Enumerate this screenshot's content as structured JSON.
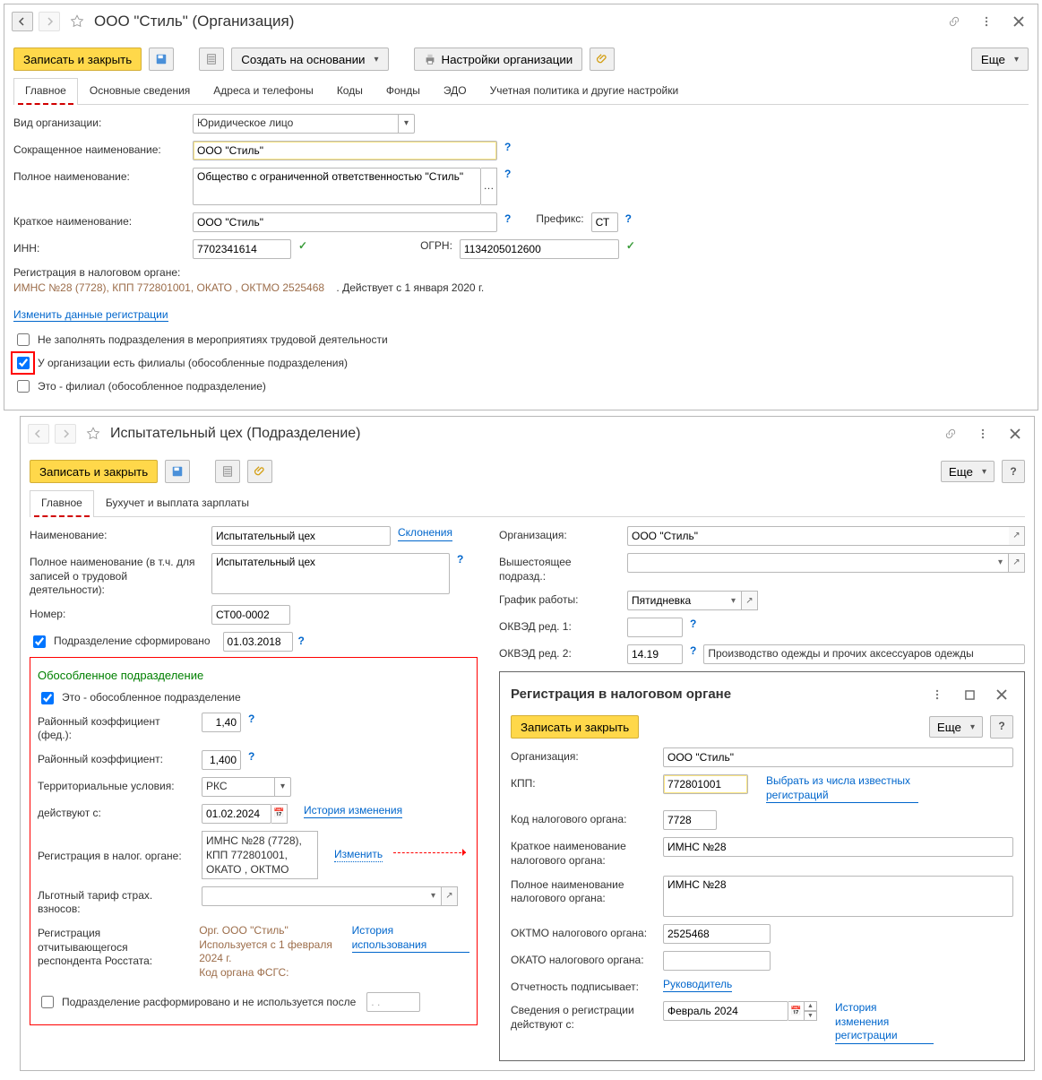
{
  "org_window": {
    "title": "ООО \"Стиль\" (Организация)",
    "toolbar": {
      "save_close": "Записать и закрыть",
      "create_from": "Создать на основании",
      "org_settings": "Настройки организации",
      "more": "Еще"
    },
    "tabs": [
      "Главное",
      "Основные сведения",
      "Адреса и телефоны",
      "Коды",
      "Фонды",
      "ЭДО",
      "Учетная политика и другие настройки"
    ],
    "fields": {
      "kind_label": "Вид организации:",
      "kind_value": "Юридическое лицо",
      "short_label": "Сокращенное наименование:",
      "short_value": "ООО \"Стиль\"",
      "full_label": "Полное наименование:",
      "full_value": "Общество с ограниченной ответственностью \"Стиль\"",
      "brief_label": "Краткое наименование:",
      "brief_value": "ООО \"Стиль\"",
      "prefix_label": "Префикс:",
      "prefix_value": "СТ",
      "inn_label": "ИНН:",
      "inn_value": "7702341614",
      "ogrn_label": "ОГРН:",
      "ogrn_value": "1134205012600",
      "tax_reg_label": "Регистрация в налоговом органе:",
      "tax_reg_text": "ИМНС №28 (7728), КПП 772801001, ОКАТО , ОКТМО 2525468",
      "tax_reg_from": ". Действует с 1 января 2020 г.",
      "change_reg": "Изменить данные регистрации",
      "cb1_label": "Не заполнять подразделения в мероприятиях трудовой деятельности",
      "cb2_label": "У организации есть филиалы (обособленные подразделения)",
      "cb3_label": "Это - филиал (обособленное подразделение)"
    }
  },
  "dept_window": {
    "title": "Испытательный цех (Подразделение)",
    "toolbar": {
      "save_close": "Записать и закрыть",
      "more": "Еще"
    },
    "tabs": [
      "Главное",
      "Бухучет и выплата зарплаты"
    ],
    "left": {
      "name_label": "Наименование:",
      "name_value": "Испытательный цех",
      "name_link": "Склонения",
      "full_label": "Полное наименование (в т.ч. для записей о трудовой деятельности):",
      "full_value": "Испытательный цех",
      "number_label": "Номер:",
      "number_value": "СТ00-0002",
      "formed_label": "Подразделение сформировано",
      "formed_date": "01.03.2018"
    },
    "right": {
      "org_label": "Организация:",
      "org_value": "ООО \"Стиль\"",
      "parent_label": "Вышестоящее подразд.:",
      "parent_value": "",
      "sched_label": "График работы:",
      "sched_value": "Пятидневка",
      "okved1_label": "ОКВЭД ред. 1:",
      "okved1_value": "",
      "okved2_label": "ОКВЭД ред. 2:",
      "okved2_value": "14.19",
      "okved2_desc": "Производство одежды и прочих аксессуаров одежды"
    },
    "obosobl": {
      "section_title": "Обособленное подразделение",
      "cb_label": "Это - обособленное подразделение",
      "rk_fed_label": "Районный коэффициент (фед.):",
      "rk_fed_value": "1,40",
      "rk_label": "Районный коэффициент:",
      "rk_value": "1,400",
      "terr_label": "Территориальные условия:",
      "terr_value": "РКС",
      "from_label": "действуют с:",
      "from_date": "01.02.2024",
      "history_link": "История изменения",
      "taxreg_label": "Регистрация в налог. органе:",
      "taxreg_value": "ИМНС №28 (7728), КПП 772801001, ОКАТО , ОКТМО",
      "change_link": "Изменить",
      "tariff_label": "Льготный тариф страх. взносов:",
      "rosstat_label": "Регистрация отчитывающегося респондента Росстата:",
      "rosstat_value": "Орг. ООО \"Стиль\"\nИспользуется с 1 февраля 2024 г.\nКод органа ФСГС:",
      "rosstat_link": "История использования",
      "disbanded_label": "Подразделение расформировано и не используется после",
      "disbanded_date": ". ."
    }
  },
  "popup": {
    "title": "Регистрация в налоговом органе",
    "save_close": "Записать и закрыть",
    "more": "Еще",
    "org_label": "Организация:",
    "org_value": "ООО \"Стиль\"",
    "kpp_label": "КПП:",
    "kpp_value": "772801001",
    "kpp_link": "Выбрать из числа известных регистраций",
    "code_label": "Код налогового органа:",
    "code_value": "7728",
    "short_label": "Краткое наименование налогового органа:",
    "short_value": "ИМНС №28",
    "full_label": "Полное наименование налогового органа:",
    "full_value": "ИМНС №28",
    "oktmo_label": "ОКТМО налогового органа:",
    "oktmo_value": "2525468",
    "okato_label": "ОКАТО налогового органа:",
    "okato_value": "",
    "signer_label": "Отчетность подписывает:",
    "signer_link": "Руководитель",
    "valid_label": "Сведения о регистрации действуют с:",
    "valid_value": "Февраль 2024",
    "valid_link": "История изменения регистрации"
  }
}
